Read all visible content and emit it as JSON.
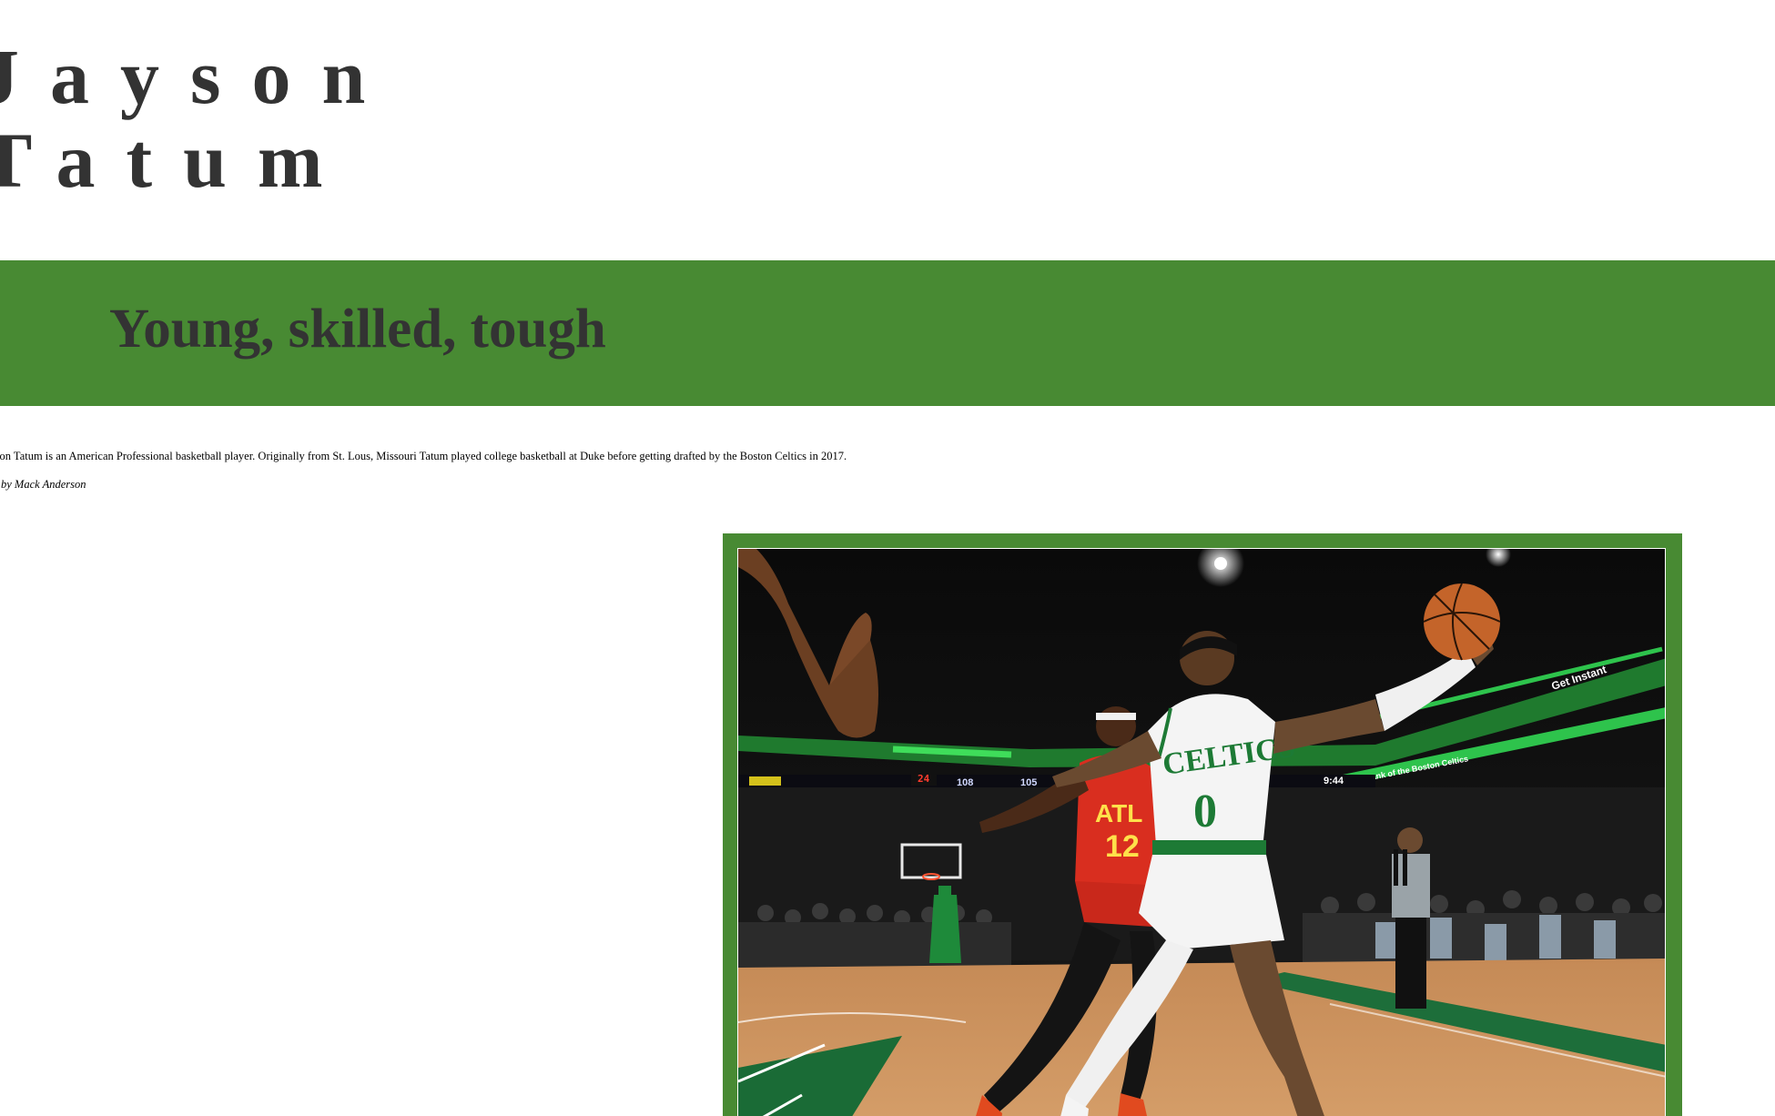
{
  "header": {
    "title_line1": "Jayson",
    "title_line2": "Tatum"
  },
  "banner": {
    "subtitle": "Young, skilled, tough"
  },
  "article": {
    "intro": "Jayson Tatum is an American Professional basketball player. Originally from St. Lous, Missouri Tatum played college basketball at Duke before getting drafted by the Boston Celtics in 2017.",
    "byline": "by Mack Anderson"
  },
  "photo": {
    "jersey_main_team": "CELTICS",
    "jersey_main_number": "0",
    "jersey_defender_team": "ATL",
    "jersey_defender_number": "12",
    "scoreboard_home": "108",
    "scoreboard_away": "105",
    "scoreboard_clock": "9:44",
    "shot_clock": "24",
    "ribbon_text": "Get Instant",
    "ribbon_text_right": "Bank of the Boston Celtics"
  },
  "colors": {
    "accent_green": "#488a33",
    "text_dark": "#333333"
  }
}
